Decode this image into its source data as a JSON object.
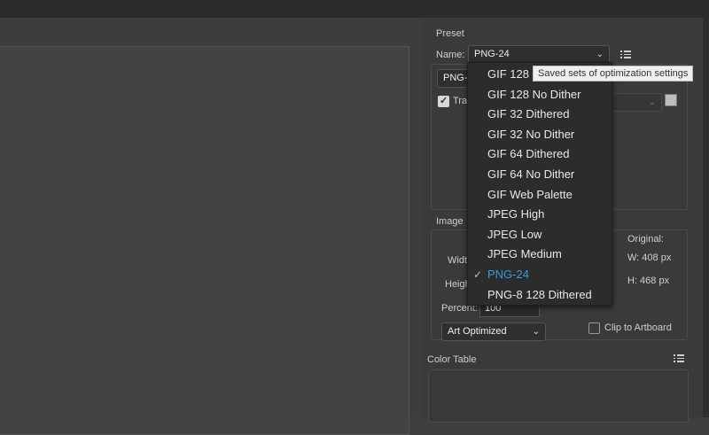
{
  "preset": {
    "section_title": "Preset",
    "name_label": "Name:",
    "name_value": "PNG-24",
    "format_value": "PNG-",
    "transparency_label": "Tra",
    "transparency_checked": true
  },
  "tooltip": "Saved sets of optimization settings",
  "dropdown": {
    "items": [
      {
        "label": "GIF 128",
        "selected": false
      },
      {
        "label": "GIF 128 No Dither",
        "selected": false
      },
      {
        "label": "GIF 32 Dithered",
        "selected": false
      },
      {
        "label": "GIF 32 No Dither",
        "selected": false
      },
      {
        "label": "GIF 64 Dithered",
        "selected": false
      },
      {
        "label": "GIF 64 No Dither",
        "selected": false
      },
      {
        "label": "GIF Web Palette",
        "selected": false
      },
      {
        "label": "JPEG High",
        "selected": false
      },
      {
        "label": "JPEG Low",
        "selected": false
      },
      {
        "label": "JPEG Medium",
        "selected": false
      },
      {
        "label": "PNG-24",
        "selected": true
      },
      {
        "label": "PNG-8 128 Dithered",
        "selected": false
      }
    ],
    "check_glyph": "✓"
  },
  "image_size": {
    "section_title": "Image",
    "width_label": "Widt",
    "height_label": "Heigh",
    "percent_label": "Percent:",
    "percent_value": "100",
    "original_label": "Original:",
    "original_w": "W:  408 px",
    "original_h": "H:  468 px",
    "quality_value": "Art Optimized",
    "clip_label": "Clip to Artboard",
    "clip_checked": false
  },
  "color_table": {
    "section_title": "Color Table"
  },
  "icons": {
    "menu": "list-menu-icon",
    "chevron": "chevron-down-icon"
  }
}
